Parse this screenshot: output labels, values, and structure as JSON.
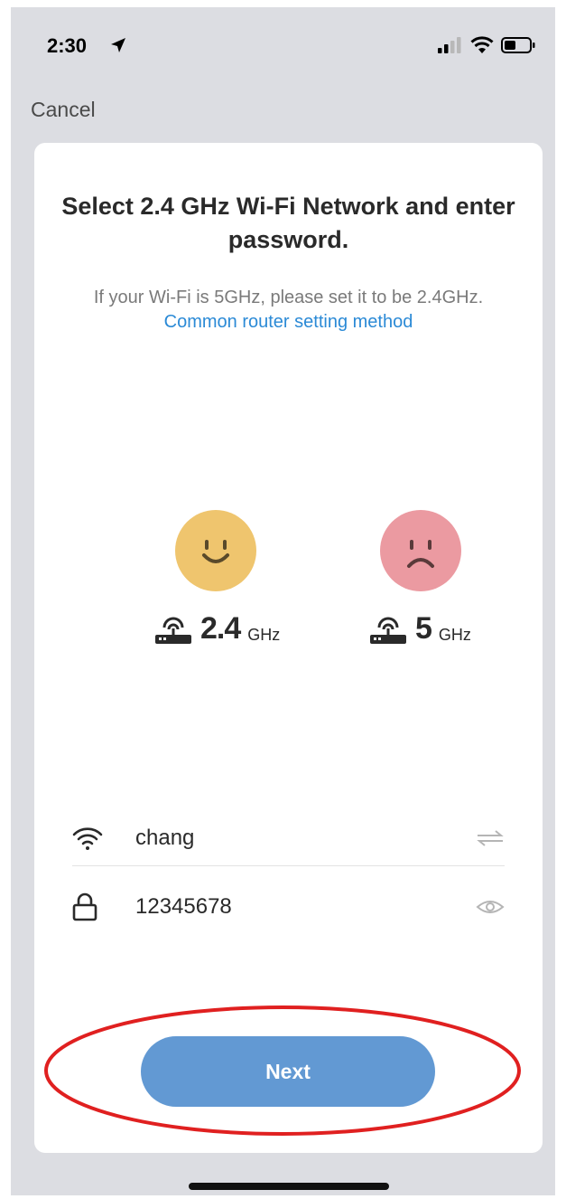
{
  "status_bar": {
    "time": "2:30",
    "icons": [
      "location-arrow-icon",
      "signal-icon",
      "wifi-icon",
      "battery-icon"
    ]
  },
  "nav": {
    "cancel_label": "Cancel"
  },
  "card": {
    "title": "Select 2.4 GHz Wi-Fi Network and enter password.",
    "subtitle_text": "If your Wi-Fi is 5GHz, please set it to be 2.4GHz.",
    "subtitle_link": "Common router setting method"
  },
  "bands": [
    {
      "number": "2.4",
      "unit": "GHz",
      "face": "smile",
      "color": "#efc56e"
    },
    {
      "number": "5",
      "unit": "GHz",
      "face": "frown",
      "color": "#eb9aa1"
    }
  ],
  "form": {
    "ssid": {
      "value": "chang",
      "lead_icon": "wifi-icon",
      "trail_icon": "switch-network-icon"
    },
    "password": {
      "value": "12345678",
      "lead_icon": "lock-icon",
      "trail_icon": "eye-icon"
    }
  },
  "next_label": "Next",
  "colors": {
    "accent": "#6299d3",
    "link": "#2b8ad6",
    "annotation": "#e02020"
  }
}
